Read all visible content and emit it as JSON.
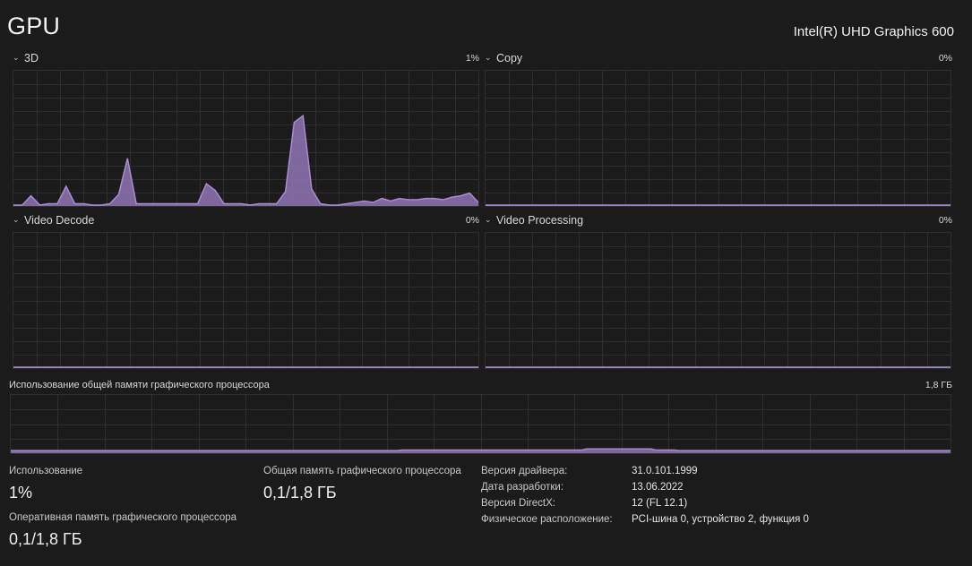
{
  "header": {
    "title": "GPU",
    "adapter_name": "Intel(R) UHD Graphics 600"
  },
  "engines": [
    {
      "name": "3D",
      "percent": "1%",
      "series": [
        0,
        0,
        7,
        0,
        1,
        1,
        14,
        1,
        1,
        0,
        0,
        1,
        8,
        35,
        1,
        1,
        1,
        1,
        1,
        1,
        1,
        1,
        16,
        11,
        1,
        1,
        1,
        0,
        1,
        1,
        1,
        10,
        62,
        67,
        12,
        1,
        0,
        0,
        1,
        2,
        3,
        2,
        5,
        3,
        5,
        4,
        4,
        5,
        5,
        4,
        6,
        7,
        9,
        2
      ]
    },
    {
      "name": "Copy",
      "percent": "0%",
      "series": []
    },
    {
      "name": "Video Decode",
      "percent": "0%",
      "series": []
    },
    {
      "name": "Video Processing",
      "percent": "0%",
      "series": []
    }
  ],
  "shared_memory": {
    "label": "Использование общей памяти графического процессора",
    "max": "1,8 ГБ",
    "series": [
      3,
      3,
      3,
      3,
      3,
      3,
      3,
      3,
      3,
      3,
      3,
      3,
      3,
      3,
      3,
      3,
      3,
      3,
      3,
      3,
      3,
      3,
      3,
      3,
      3,
      3,
      3,
      3,
      3,
      3,
      3,
      3,
      3,
      3,
      3,
      3,
      3,
      3,
      3,
      3,
      3,
      3,
      3,
      3,
      3,
      3,
      3,
      3,
      3,
      3,
      3,
      3,
      3,
      3,
      3,
      3,
      3,
      3,
      3,
      3,
      3,
      3,
      3,
      3,
      3,
      3,
      3,
      3,
      3,
      3,
      3,
      3,
      3,
      3,
      3,
      3,
      3,
      3,
      3,
      3,
      3,
      3,
      3,
      3,
      3,
      3,
      3,
      3,
      3,
      3,
      3,
      3,
      3,
      3,
      3,
      3,
      3,
      3,
      3,
      3,
      3,
      3,
      3,
      3,
      3,
      3,
      3,
      3,
      3,
      3,
      3,
      3,
      3,
      3,
      3,
      3,
      3,
      3,
      3,
      3,
      3,
      3,
      3,
      3,
      3,
      3,
      3,
      3,
      3,
      3,
      3,
      3,
      3,
      3,
      3,
      3,
      3,
      3,
      3,
      3,
      3,
      3,
      3,
      3,
      3,
      3,
      3,
      3,
      3,
      3,
      3,
      3,
      3,
      3,
      3,
      3,
      3,
      3,
      3,
      3,
      3,
      3,
      3,
      3,
      3,
      3,
      3,
      3,
      3,
      3,
      3,
      3,
      3,
      3,
      3,
      3,
      3,
      3,
      3,
      3,
      3,
      3,
      3,
      3,
      3,
      3,
      3,
      3,
      3,
      3,
      3,
      3,
      3,
      3,
      3,
      3,
      3,
      3,
      3,
      3,
      3,
      3,
      3,
      3,
      3
    ]
  },
  "stats": {
    "usage_label": "Использование",
    "usage_value": "1%",
    "dedicated_label": "Оперативная память графического процессора",
    "dedicated_value": "0,1/1,8 ГБ",
    "shared_label": "Общая память графического процессора",
    "shared_value": "0,1/1,8 ГБ"
  },
  "info": [
    {
      "key": "Версия драйвера:",
      "value": "31.0.101.1999"
    },
    {
      "key": "Дата разработки:",
      "value": "13.06.2022"
    },
    {
      "key": "Версия DirectX:",
      "value": "12 (FL 12.1)"
    },
    {
      "key": "Физическое расположение:",
      "value": "PCI-шина 0, устройство 2, функция 0"
    }
  ],
  "colors": {
    "accent_line": "#a98bd0",
    "accent_fill": "#8f74b3",
    "grid": "#2e2e2e",
    "background": "#1b1b1b"
  }
}
